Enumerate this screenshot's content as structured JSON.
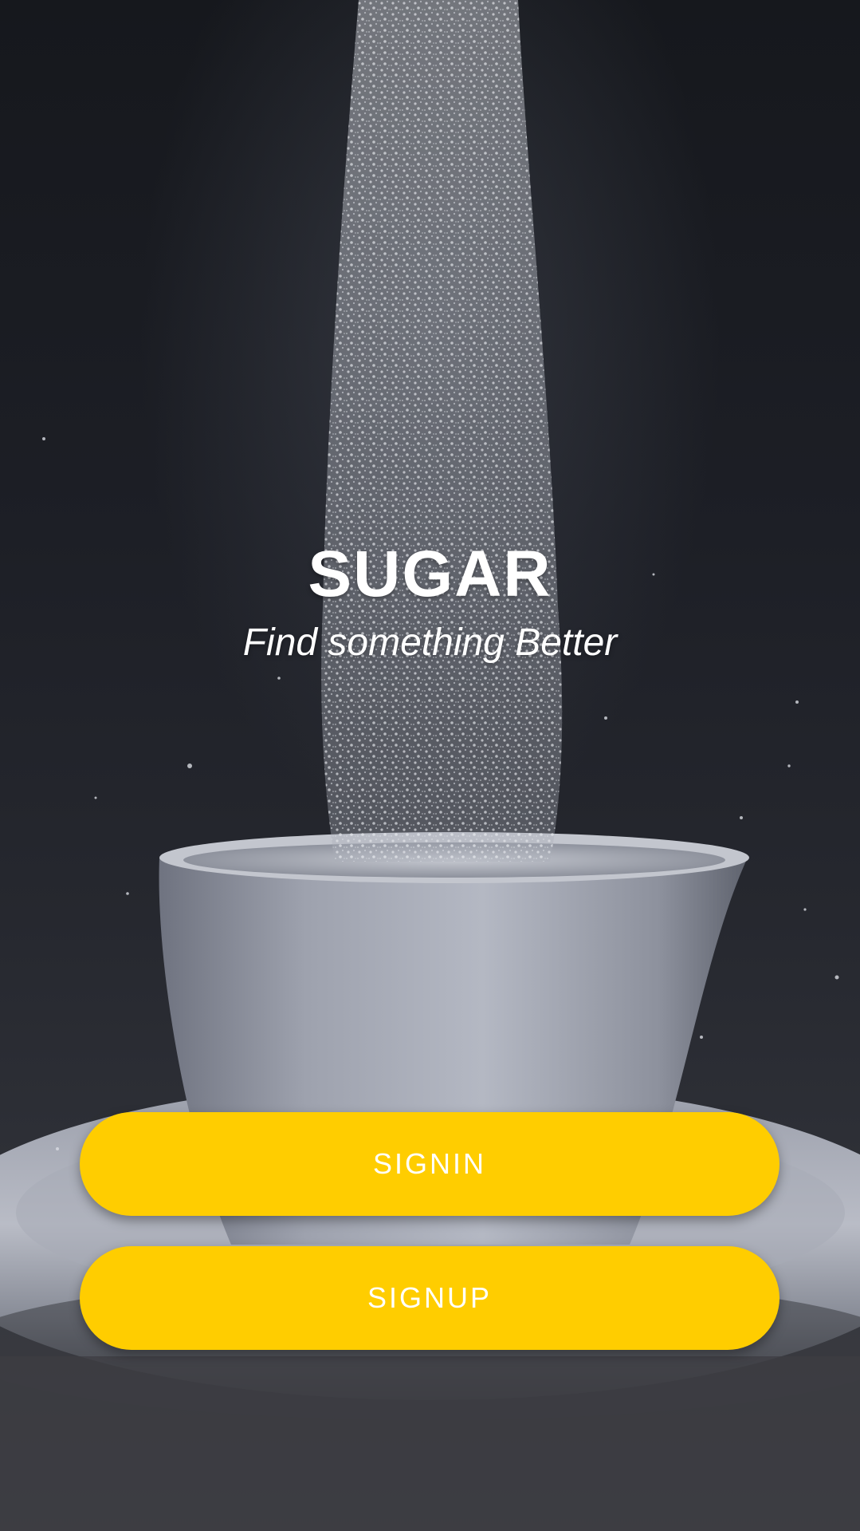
{
  "app": {
    "title": "SUGAR",
    "tagline": "Find something Better"
  },
  "actions": {
    "signin_label": "SIGNIN",
    "signup_label": "SIGNUP"
  },
  "colors": {
    "button_background": "#ffcd00",
    "button_text": "#ffffff",
    "title_text": "#ffffff",
    "background_dark": "#16181d"
  },
  "background_image": {
    "subject": "sugar pouring into a white cup on a saucer"
  }
}
